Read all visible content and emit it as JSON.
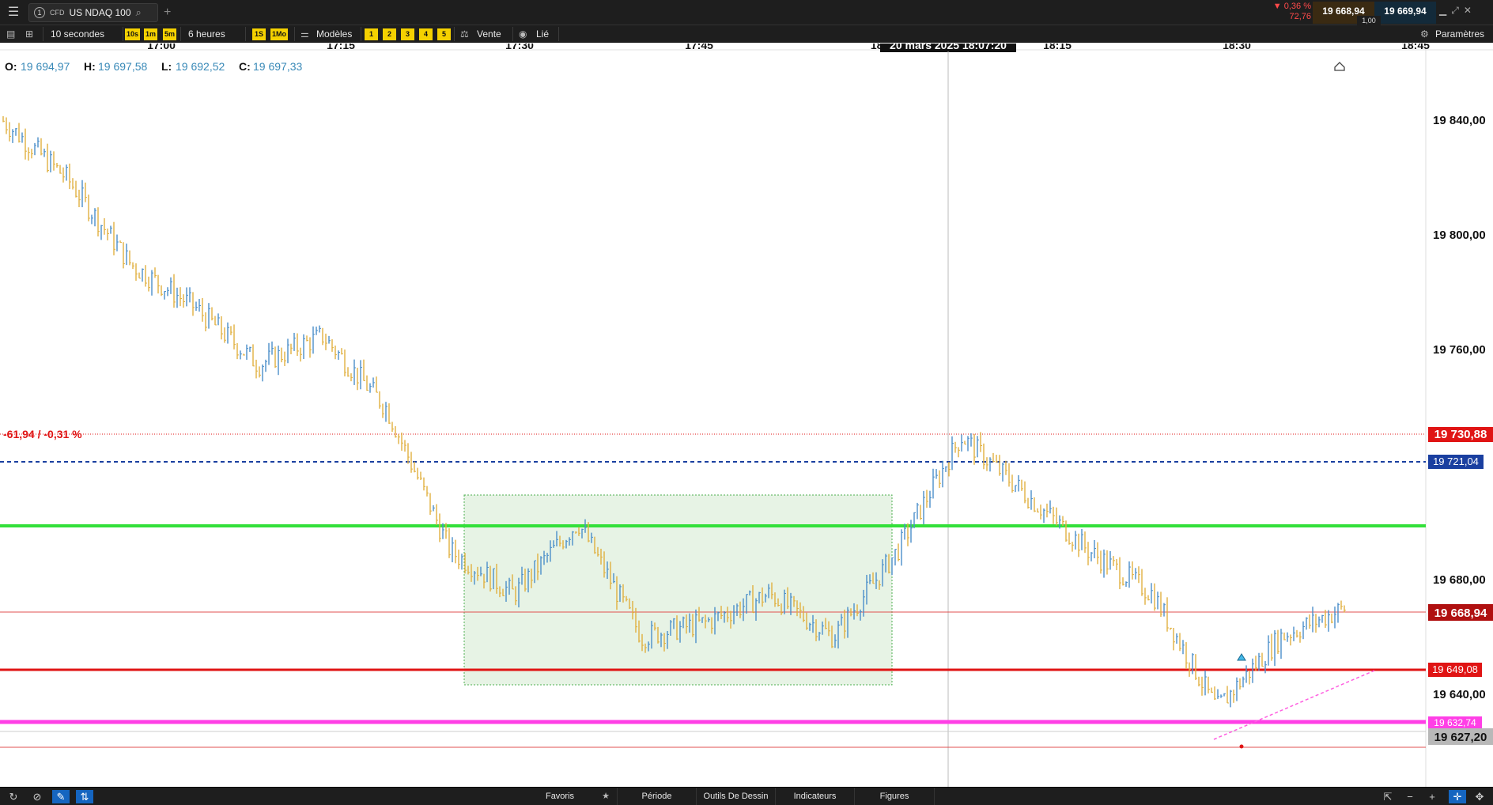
{
  "topbar": {
    "tab_number": "1",
    "instrument_type": "CFD",
    "instrument_name": "US NDAQ 100",
    "change_percent": "▼ 0,36 %",
    "change_points": "72,76",
    "sell_price": "19 668,94",
    "buy_price": "19 669,94",
    "spread": "1,00"
  },
  "toolbar": {
    "interval": "10 secondes",
    "range": "6 heures",
    "quick_intervals": [
      "10s",
      "1m",
      "5m"
    ],
    "quick_ranges": [
      "1S",
      "1Mo"
    ],
    "templates_label": "Modèles",
    "template_slots": [
      "1",
      "2",
      "3",
      "4",
      "5"
    ],
    "price_type": "Vente",
    "linked_label": "Lié",
    "settings_label": "Paramètres"
  },
  "chart": {
    "time_labels": [
      "17:00",
      "17:15",
      "17:30",
      "17:45",
      "18:15",
      "18:30",
      "18:45"
    ],
    "crosshair_label": "20 mars 2025 18:07:20",
    "ohlc": {
      "o_label": "O:",
      "o_value": "19 694,97",
      "h_label": "H:",
      "h_value": "19 697,58",
      "l_label": "L:",
      "l_value": "19 692,52",
      "c_label": "C:",
      "c_value": "19 697,33"
    },
    "price_labels": [
      "19 840,00",
      "19 800,00",
      "19 760,00",
      "19 680,00",
      "19 640,00"
    ],
    "reference_change": "-61,94 / -0,31 %",
    "tags": {
      "reference": "19 730,88",
      "order": "19 721,04",
      "current": "19 668,94",
      "support": "19 649,08",
      "magenta": "19 632,74",
      "low": "19 627,20"
    },
    "colors": {
      "reference": "#e01414",
      "order": "#1a3fa0",
      "green_line": "#33e03a",
      "support": "#e01414",
      "magenta": "#ff3fe6",
      "bull": "#4b8fc9",
      "bear": "#e0b040"
    }
  },
  "chart_data": {
    "type": "candlestick",
    "x": [
      "16:55",
      "17:00",
      "17:05",
      "17:10",
      "17:15",
      "17:20",
      "17:25",
      "17:30",
      "17:35",
      "17:40",
      "17:45",
      "17:50",
      "17:55",
      "18:00",
      "18:05",
      "18:10",
      "18:15",
      "18:20",
      "18:25",
      "18:30",
      "18:35",
      "18:40"
    ],
    "close": [
      19840,
      19820,
      19790,
      19775,
      19755,
      19765,
      19740,
      19690,
      19675,
      19700,
      19660,
      19665,
      19675,
      19660,
      19690,
      19730,
      19710,
      19690,
      19675,
      19635,
      19660,
      19670
    ],
    "ylim": [
      19610,
      19860
    ],
    "price_axis": [
      19840,
      19800,
      19760,
      19680,
      19640
    ],
    "range_box": {
      "start": "17:29",
      "end": "18:06",
      "high": 19710,
      "low": 19660
    }
  },
  "bottombar": {
    "favorites": "Favoris",
    "period": "Période",
    "drawing_tools": "Outils De Dessin",
    "indicators": "Indicateurs",
    "figures": "Figures"
  }
}
